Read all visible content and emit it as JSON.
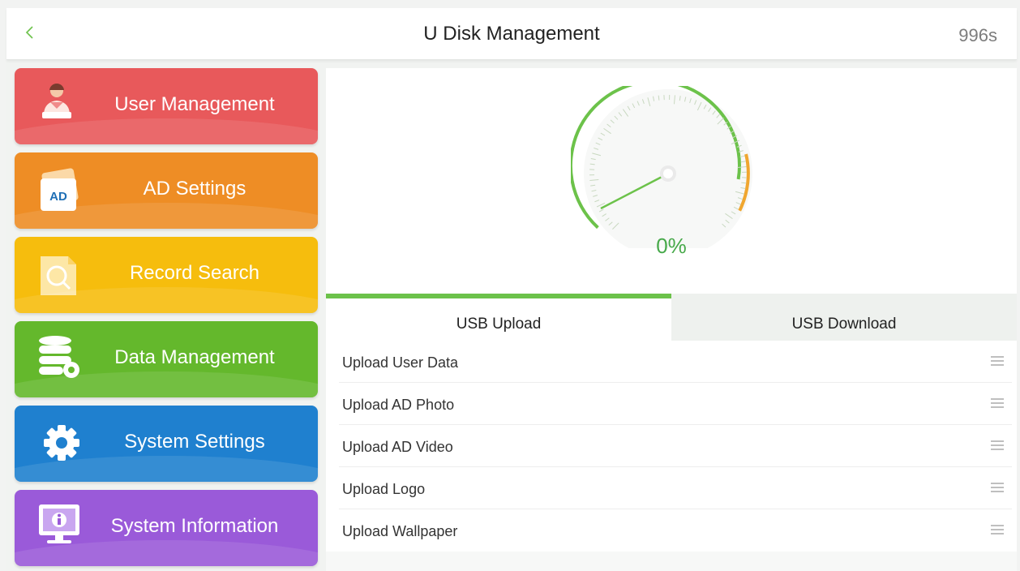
{
  "header": {
    "title": "U Disk Management",
    "timer": "996s",
    "back_icon": "chevron-left-icon"
  },
  "menu": {
    "items": [
      {
        "label": "User Management",
        "icon": "user-icon",
        "color": "#e8595b"
      },
      {
        "label": "AD Settings",
        "icon": "ad-icon",
        "icon_text": "AD",
        "color": "#ee8d25"
      },
      {
        "label": "Record Search",
        "icon": "search-document-icon",
        "color": "#f6bd0d"
      },
      {
        "label": "Data Management",
        "icon": "database-gear-icon",
        "color": "#64b82c"
      },
      {
        "label": "System Settings",
        "icon": "gear-icon",
        "color": "#1f80cf"
      },
      {
        "label": "System Information",
        "icon": "monitor-info-icon",
        "color": "#9a5ad9"
      }
    ]
  },
  "gauge": {
    "percent_text": "0%",
    "value": 0,
    "accent_green": "#6cc24a",
    "accent_orange": "#f0a62f"
  },
  "tabs": [
    {
      "label": "USB Upload",
      "active": true
    },
    {
      "label": "USB Download",
      "active": false
    }
  ],
  "upload_list": {
    "items": [
      {
        "label": "Upload User Data"
      },
      {
        "label": "Upload AD Photo"
      },
      {
        "label": "Upload AD Video"
      },
      {
        "label": "Upload Logo"
      },
      {
        "label": "Upload Wallpaper"
      }
    ],
    "row_icon": "drag-handle-icon"
  }
}
